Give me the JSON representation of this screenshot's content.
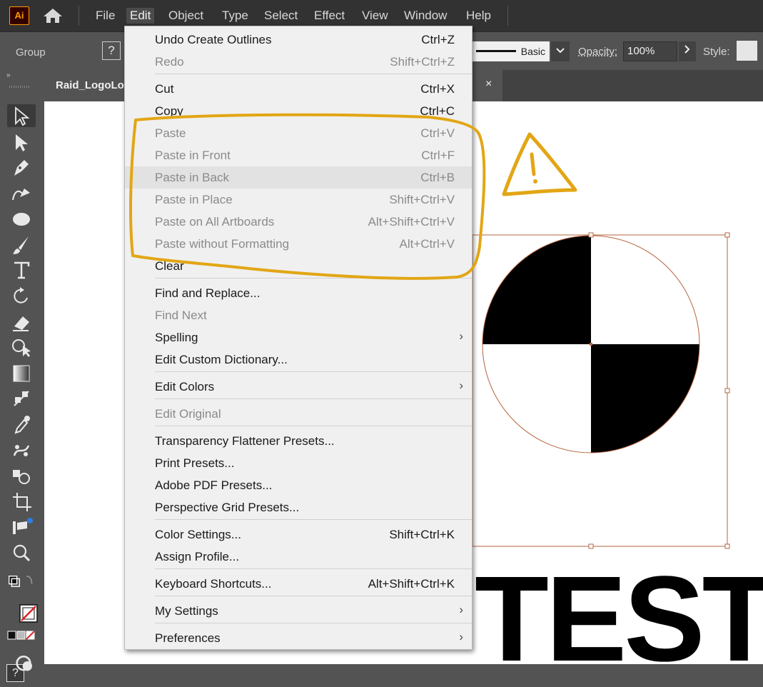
{
  "menubar": {
    "app_logo": "Ai",
    "items": [
      {
        "label": "File"
      },
      {
        "label": "Edit"
      },
      {
        "label": "Object"
      },
      {
        "label": "Type"
      },
      {
        "label": "Select"
      },
      {
        "label": "Effect"
      },
      {
        "label": "View"
      },
      {
        "label": "Window"
      },
      {
        "label": "Help"
      }
    ],
    "active_item": "Edit"
  },
  "controlbar": {
    "selection_label": "Group",
    "help_icon": "?",
    "stroke_profile": "Basic",
    "dropdown_icon": "chevron-down-icon",
    "opacity_label": "Opacity:",
    "opacity_value": "100%",
    "opacity_arrow_icon": "chevron-right-icon",
    "style_label": "Style:"
  },
  "document_tab": {
    "title": "Raid_LogoLo",
    "close_icon": "×"
  },
  "toolbar": {
    "collapse_icon": "»",
    "help_icon": "?"
  },
  "canvas": {
    "artwork_text": "TEST"
  },
  "edit_menu": {
    "submenu_icon": "›",
    "items": [
      {
        "label": "Undo Create Outlines",
        "shortcut": "Ctrl+Z"
      },
      {
        "label": "Redo",
        "shortcut": "Shift+Ctrl+Z"
      },
      {
        "label": "Cut",
        "shortcut": "Ctrl+X"
      },
      {
        "label": "Copy",
        "shortcut": "Ctrl+C"
      },
      {
        "label": "Paste",
        "shortcut": "Ctrl+V"
      },
      {
        "label": "Paste in Front",
        "shortcut": "Ctrl+F"
      },
      {
        "label": "Paste in Back",
        "shortcut": "Ctrl+B"
      },
      {
        "label": "Paste in Place",
        "shortcut": "Shift+Ctrl+V"
      },
      {
        "label": "Paste on All Artboards",
        "shortcut": "Alt+Shift+Ctrl+V"
      },
      {
        "label": "Paste without Formatting",
        "shortcut": "Alt+Ctrl+V"
      },
      {
        "label": "Clear"
      },
      {
        "label": "Find and Replace..."
      },
      {
        "label": "Find Next"
      },
      {
        "label": "Spelling"
      },
      {
        "label": "Edit Custom Dictionary..."
      },
      {
        "label": "Edit Colors"
      },
      {
        "label": "Edit Original"
      },
      {
        "label": "Transparency Flattener Presets..."
      },
      {
        "label": "Print Presets..."
      },
      {
        "label": "Adobe PDF Presets..."
      },
      {
        "label": "Perspective Grid Presets..."
      },
      {
        "label": "Color Settings...",
        "shortcut": "Shift+Ctrl+K"
      },
      {
        "label": "Assign Profile..."
      },
      {
        "label": "Keyboard Shortcuts...",
        "shortcut": "Alt+Shift+Ctrl+K"
      },
      {
        "label": "My Settings"
      },
      {
        "label": "Preferences"
      }
    ],
    "disabled_items": [
      "Redo",
      "Paste",
      "Paste in Front",
      "Paste in Back",
      "Paste in Place",
      "Paste on All Artboards",
      "Paste without Formatting",
      "Find Next",
      "Edit Original"
    ],
    "hovered_item": "Paste in Back"
  },
  "annotation": {
    "highlight_color": "#e2a615",
    "warning_icon": "warning-triangle-icon"
  }
}
